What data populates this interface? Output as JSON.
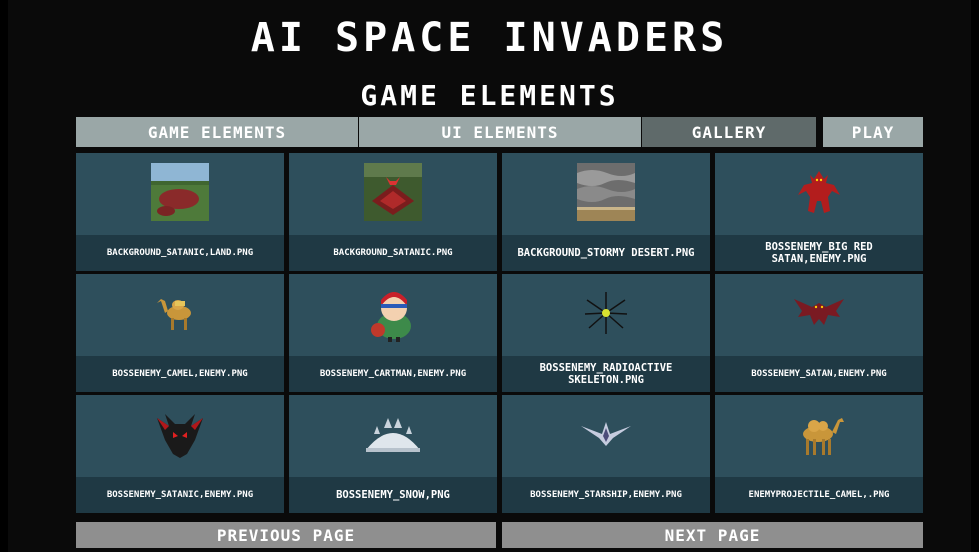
{
  "title": "AI SPACE INVADERS",
  "subtitle": "GAME ELEMENTS",
  "tabs": {
    "game_elements": "GAME ELEMENTS",
    "ui_elements": "UI ELEMENTS",
    "gallery": "GALLERY",
    "play": "PLAY"
  },
  "items": [
    {
      "label": "BACKGROUND_SATANIC,LAND.PNG",
      "icon": "landscape-image-icon"
    },
    {
      "label": "BACKGROUND_SATANIC.PNG",
      "icon": "satanic-temple-image-icon"
    },
    {
      "label": "BACKGROUND_STORMY DESERT.PNG",
      "icon": "stormy-desert-image-icon"
    },
    {
      "label": "BOSSENEMY_BIG RED SATAN,ENEMY.PNG",
      "icon": "red-demon-sprite-icon"
    },
    {
      "label": "BOSSENEMY_CAMEL,ENEMY.PNG",
      "icon": "camel-sprite-icon"
    },
    {
      "label": "BOSSENEMY_CARTMAN,ENEMY.PNG",
      "icon": "cartoon-kid-sprite-icon"
    },
    {
      "label": "BOSSENEMY_RADIOACTIVE SKELETON.PNG",
      "icon": "radioactive-skeleton-sprite-icon"
    },
    {
      "label": "BOSSENEMY_SATAN,ENEMY.PNG",
      "icon": "winged-demon-sprite-icon"
    },
    {
      "label": "BOSSENEMY_SATANIC,ENEMY.PNG",
      "icon": "demon-head-sprite-icon"
    },
    {
      "label": "BOSSENEMY_SNOW,PNG",
      "icon": "snow-dome-sprite-icon"
    },
    {
      "label": "BOSSENEMY_STARSHIP,ENEMY.PNG",
      "icon": "starship-sprite-icon"
    },
    {
      "label": "ENEMYPROJECTILE_CAMEL,.PNG",
      "icon": "camel-projectile-sprite-icon"
    }
  ],
  "pager": {
    "previous": "PREVIOUS PAGE",
    "next": "NEXT PAGE"
  },
  "colors": {
    "card": "#2e4f5c",
    "card_label": "#1f3944",
    "tab": "#9aa7a7",
    "tab_active": "#5f6a6a",
    "pager": "#8f8f8f"
  }
}
